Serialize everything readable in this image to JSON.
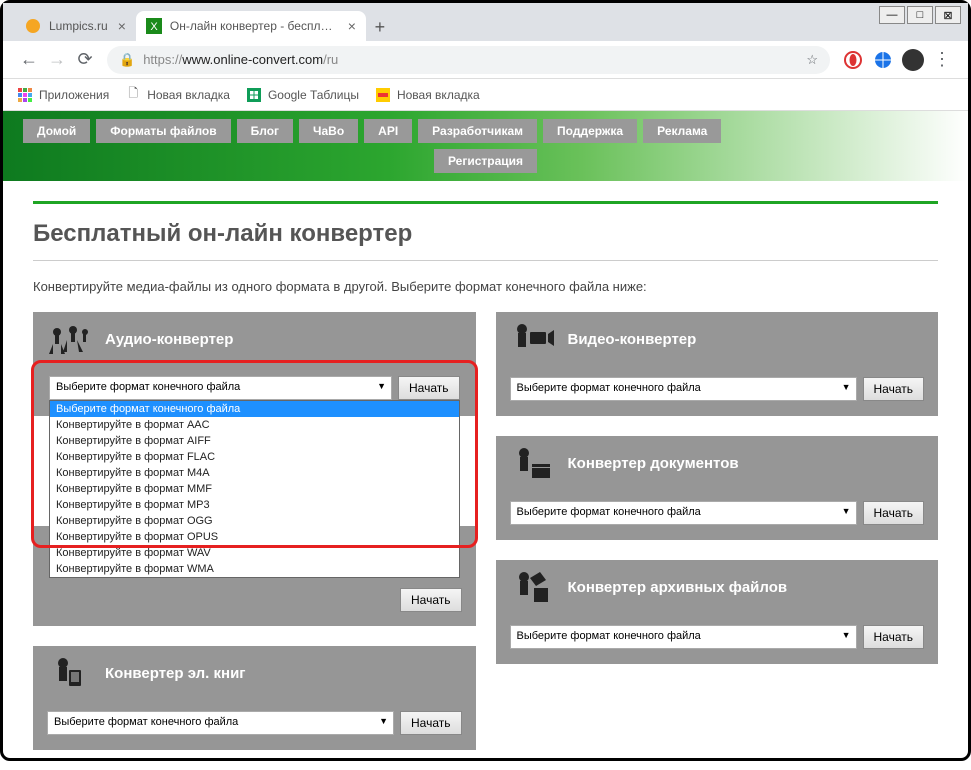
{
  "window_controls": {
    "min": "—",
    "max": "□",
    "close": "⊠"
  },
  "tabs": [
    {
      "title": "Lumpics.ru",
      "active": false
    },
    {
      "title": "Он-лайн конвертер - бесплатно...",
      "active": true
    }
  ],
  "toolbar": {
    "url_prefix": "https://",
    "url_host": "www.online-convert.com",
    "url_path": "/ru"
  },
  "bookmarks": [
    {
      "label": "Приложения"
    },
    {
      "label": "Новая вкладка"
    },
    {
      "label": "Google Таблицы"
    },
    {
      "label": "Новая вкладка"
    }
  ],
  "nav": {
    "row1": [
      "Домой",
      "Форматы файлов",
      "Блог",
      "ЧаВо",
      "API",
      "Разработчикам",
      "Поддержка",
      "Реклама"
    ],
    "row2": [
      "Регистрация"
    ]
  },
  "page_title": "Бесплатный он-лайн конвертер",
  "subtitle": "Конвертируйте медиа-файлы из одного формата в другой. Выберите формат конечного файла ниже:",
  "select_placeholder": "Выберите формат конечного файла",
  "start_label": "Начать",
  "cards": {
    "audio": "Аудио-конвертер",
    "video": "Видео-конвертер",
    "hidden1": "",
    "docs": "Конвертер документов",
    "ebooks": "Конвертер эл. книг",
    "archive": "Конвертер архивных файлов"
  },
  "dropdown": [
    "Выберите формат конечного файла",
    "Конвертируйте в формат AAC",
    "Конвертируйте в формат AIFF",
    "Конвертируйте в формат FLAC",
    "Конвертируйте в формат M4A",
    "Конвертируйте в формат MMF",
    "Конвертируйте в формат MP3",
    "Конвертируйте в формат OGG",
    "Конвертируйте в формат OPUS",
    "Конвертируйте в формат WAV",
    "Конвертируйте в формат WMA"
  ]
}
